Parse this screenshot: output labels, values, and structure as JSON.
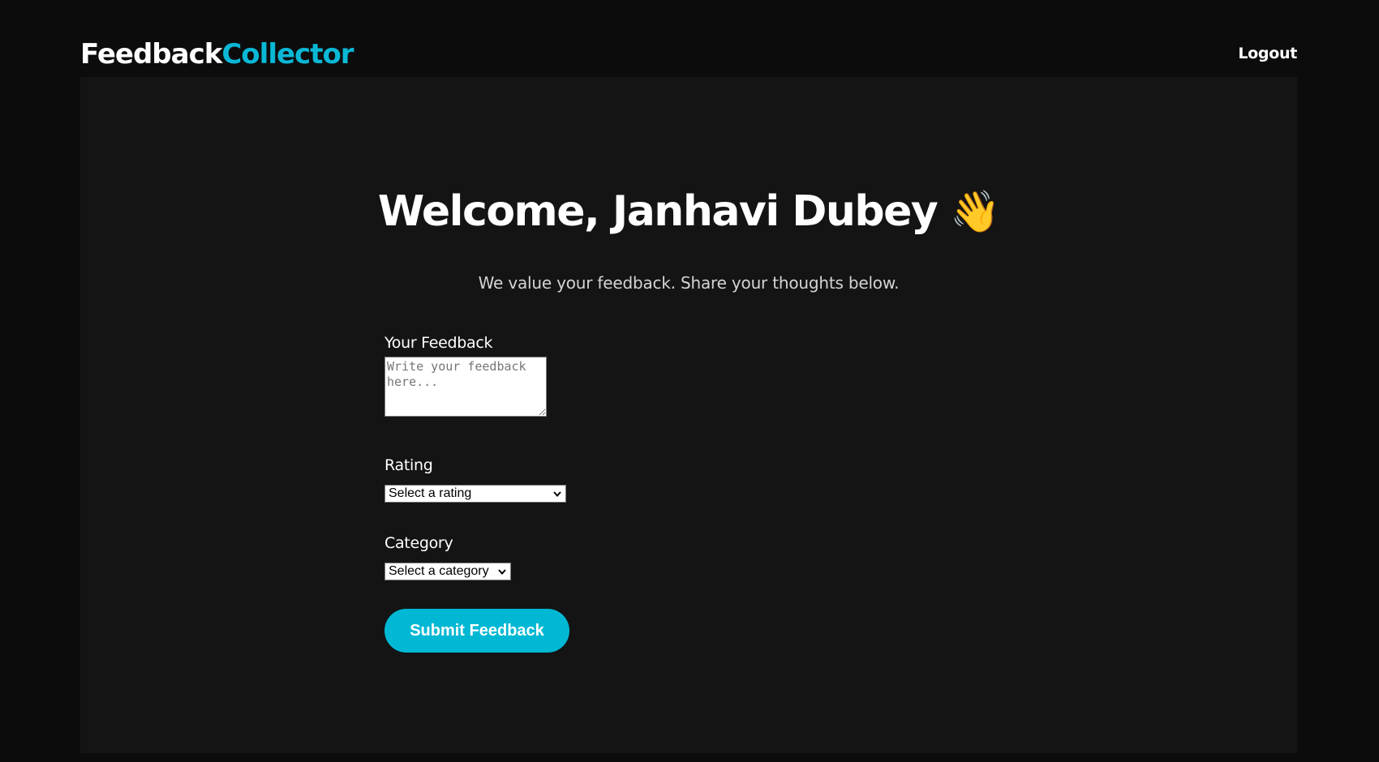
{
  "header": {
    "logo_part1": "Feedback",
    "logo_part2": "Collector",
    "logout_label": "Logout"
  },
  "main": {
    "welcome": "Welcome, Janhavi Dubey",
    "wave_emoji": "👋",
    "subtitle": "We value your feedback. Share your thoughts below."
  },
  "form": {
    "feedback_label": "Your Feedback",
    "feedback_placeholder": "Write your feedback here...",
    "feedback_value": "",
    "rating_label": "Rating",
    "rating_selected": "Select a rating",
    "category_label": "Category",
    "category_selected": "Select a category",
    "submit_label": "Submit Feedback"
  },
  "colors": {
    "accent": "#00b8d4",
    "background": "#0c0c0d",
    "panel": "#141415"
  }
}
